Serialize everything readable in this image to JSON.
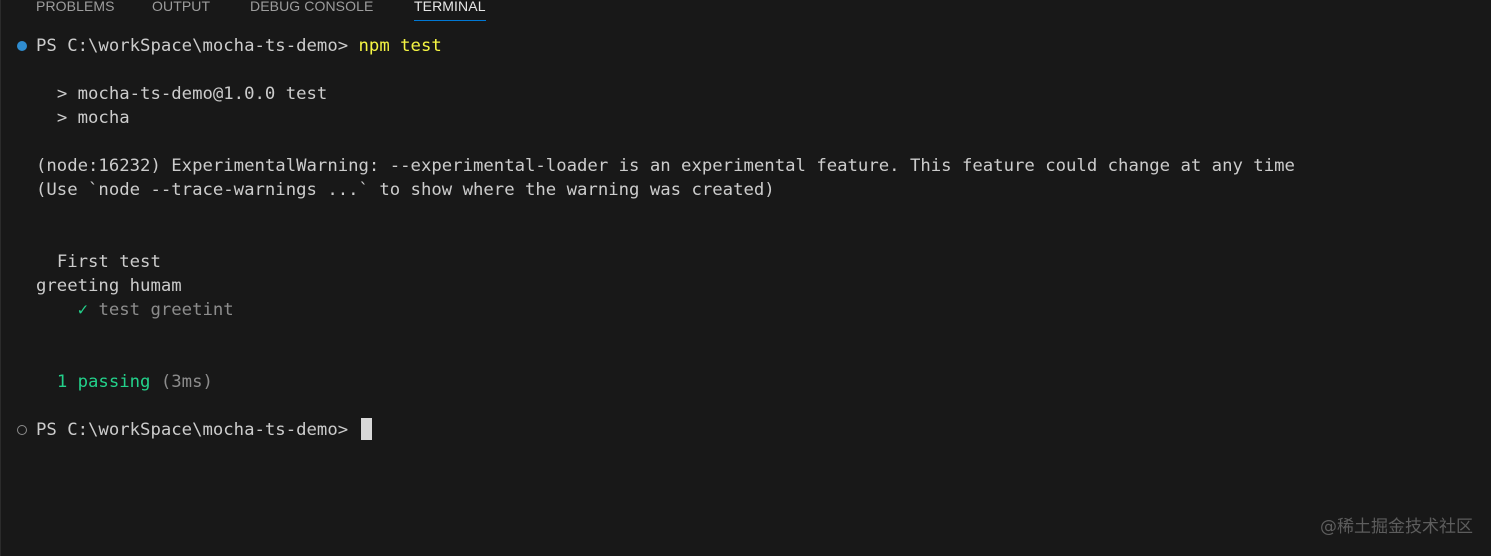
{
  "tabs": [
    {
      "label": "PROBLEMS",
      "active": false
    },
    {
      "label": "OUTPUT",
      "active": false
    },
    {
      "label": "DEBUG CONSOLE",
      "active": false
    },
    {
      "label": "TERMINAL",
      "active": true
    }
  ],
  "terminal": {
    "prompt1": "PS C:\\workSpace\\mocha-ts-demo> ",
    "command": "npm test",
    "script_line1": "> mocha-ts-demo@1.0.0 test",
    "script_line2": "> mocha",
    "warning_line1": "(node:16232) ExperimentalWarning: --experimental-loader is an experimental feature. This feature could change at any time",
    "warning_line2": "(Use `node --trace-warnings ...` to show where the warning was created)",
    "suite_title": "First test",
    "suite_sub": "greeting humam",
    "check_mark": "✓",
    "test_name": "test greetint",
    "passing_count": "1 passing",
    "passing_time": "(3ms)",
    "prompt2": "PS C:\\workSpace\\mocha-ts-demo> "
  },
  "watermark": "@稀土掘金技术社区",
  "colors": {
    "background": "#181818",
    "text": "#cccccc",
    "command": "#f5f543",
    "success": "#23d18b",
    "dim": "#8c8c8c",
    "accent": "#0078d4",
    "decoration_success": "#2f8ccf"
  },
  "icons": {
    "command_decoration_done": "filled-circle",
    "command_decoration_pending": "hollow-circle",
    "pass_mark": "check-icon"
  }
}
